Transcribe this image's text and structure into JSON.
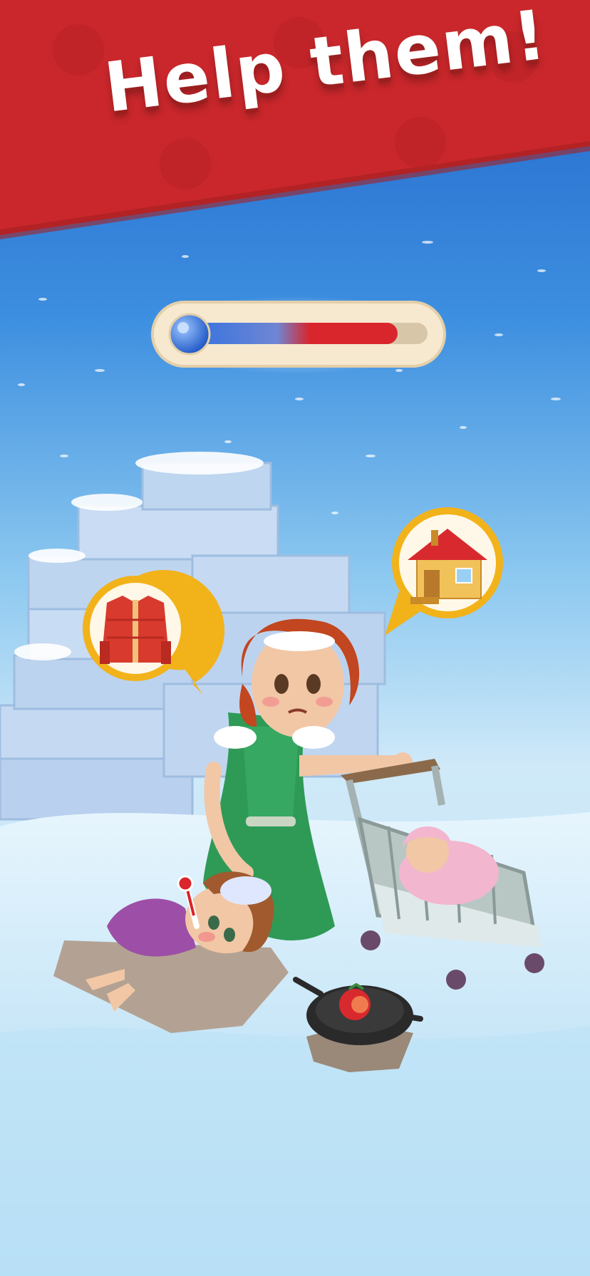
{
  "banner": {
    "title": "Help them!"
  },
  "temperature_meter": {
    "level": 0.88,
    "icon": "thermometer-icon"
  },
  "need_bubbles": [
    {
      "icon": "winter-jacket-icon"
    },
    {
      "icon": "house-icon"
    }
  ],
  "colors": {
    "banner_red": "#c9272b",
    "sky_blue": "#2f7fdc",
    "bubble_gold": "#f2b21a",
    "thermo_red": "#d9252c",
    "thermo_blue": "#2a6fe0"
  }
}
